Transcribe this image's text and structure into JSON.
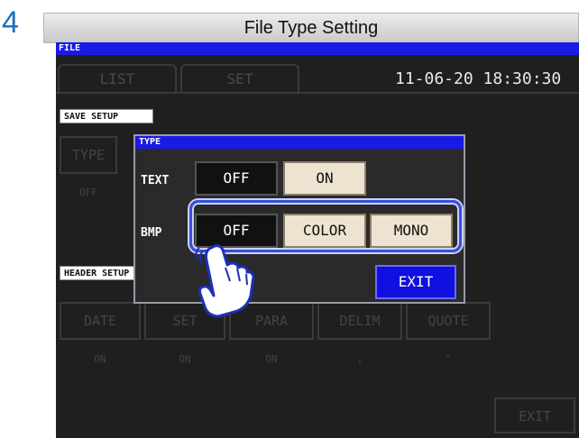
{
  "step_number": "4",
  "header_title": "File Type Setting",
  "screen": {
    "window_title": "FILE",
    "tabs": [
      {
        "label": "LIST"
      },
      {
        "label": "SET"
      }
    ],
    "datetime": "11-06-20 18:30:30",
    "save_setup": {
      "label": "SAVE SETUP",
      "type_button": "TYPE",
      "type_value": "OFF"
    },
    "header_setup": {
      "label": "HEADER SETUP",
      "buttons": [
        {
          "label": "DATE",
          "value": "ON"
        },
        {
          "label": "SET",
          "value": "ON"
        },
        {
          "label": "PARA",
          "value": "ON"
        },
        {
          "label": "DELIM",
          "value": ","
        },
        {
          "label": "QUOTE",
          "value": "\""
        }
      ]
    },
    "exit_label": "EXIT"
  },
  "dialog": {
    "title": "TYPE",
    "text_row": {
      "label": "TEXT",
      "options": [
        "OFF",
        "ON"
      ],
      "selected": "OFF"
    },
    "bmp_row": {
      "label": "BMP",
      "options": [
        "OFF",
        "COLOR",
        "MONO"
      ],
      "selected": "OFF"
    },
    "exit_label": "EXIT"
  },
  "colors": {
    "accent_blue": "#1a1ae6",
    "step_blue": "#1a6fc4",
    "highlight": "#3b4fd6"
  },
  "icons": {
    "finger": "tap-finger-icon"
  }
}
